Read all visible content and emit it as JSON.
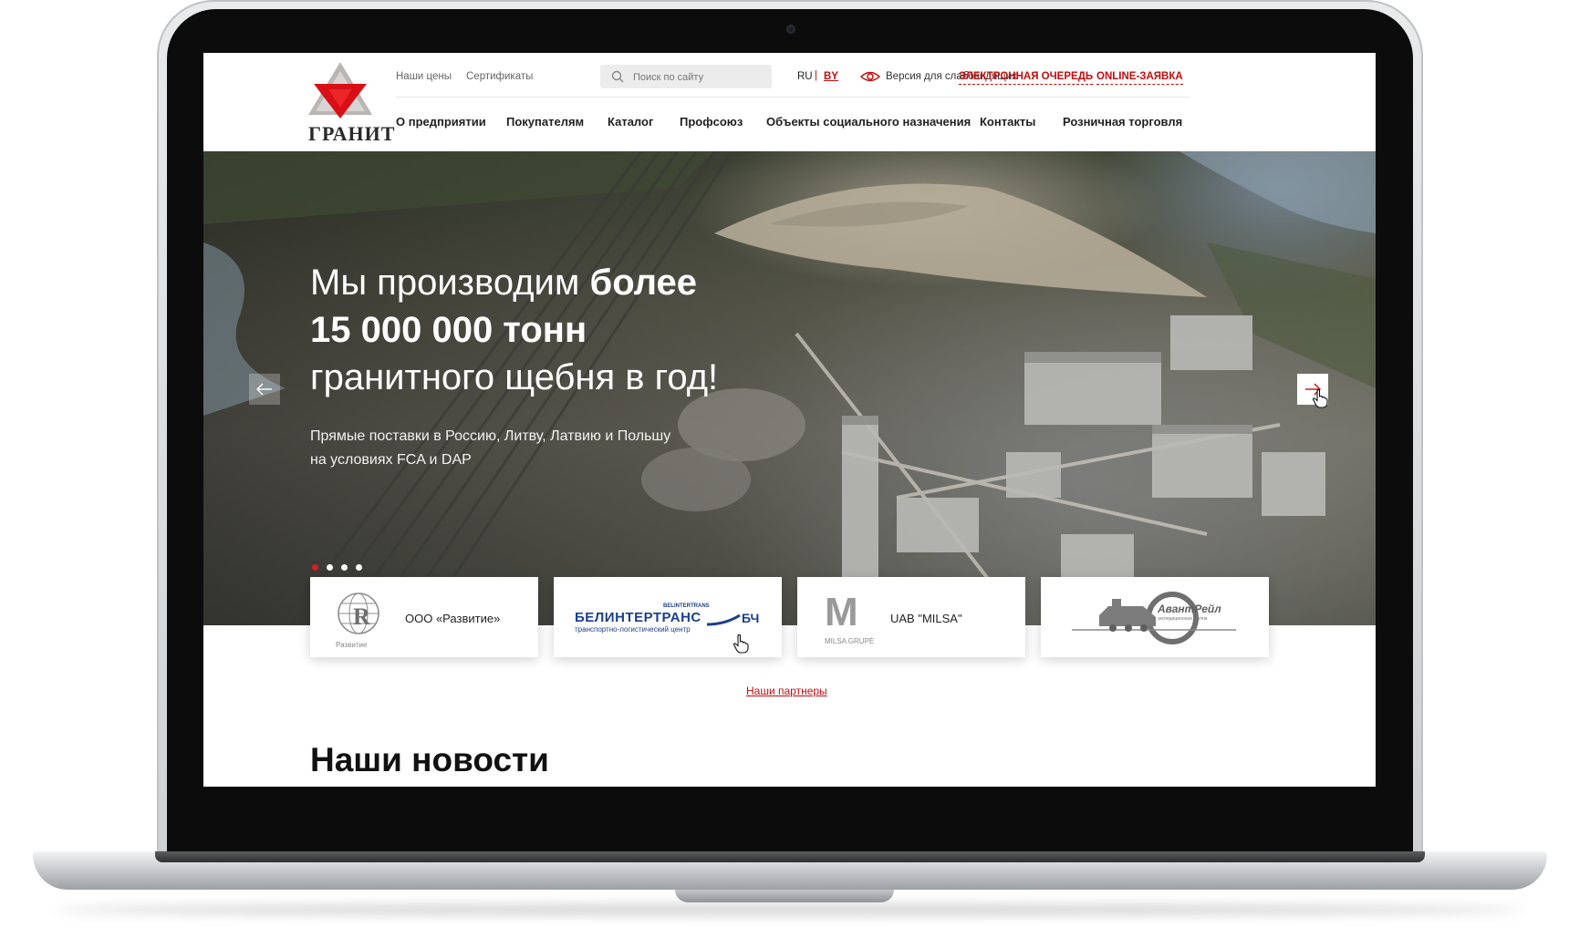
{
  "header": {
    "logo_text": "ГРАНИТ",
    "top_links": [
      "Наши цены",
      "Сертификаты"
    ],
    "search_placeholder": "Поиск по сайту",
    "lang_ru": "RU",
    "lang_sep": "|",
    "lang_by": "BY",
    "vision_label": "Версия для слабовидящих",
    "queue_label": "ЭЛЕКТРОННАЯ ОЧЕРЕДЬ",
    "online_label": "ONLINE-ЗАЯВКА",
    "nav": [
      "О предприятии",
      "Покупателям",
      "Каталог",
      "Профсоюз",
      "Объекты социального назначения",
      "Контакты",
      "Розничная торговля"
    ]
  },
  "hero": {
    "title_line1_light": "Мы производим ",
    "title_line1_bold": "более",
    "title_line2_bold": "15 000 000 тонн",
    "title_line3_light": "гранитного щебня в год!",
    "subtitle_line1": "Прямые поставки в Россию, Литву, Латвию и Польшу",
    "subtitle_line2": "на условиях FCA и DAP",
    "slide_count": 4,
    "active_slide": 1
  },
  "partners": {
    "items": [
      {
        "logo_caption": "Развитие",
        "name": "ООО «Развитие»"
      },
      {
        "logo_title": "БЕЛИНТЕРТРАНС",
        "logo_small": "BELINTERTRANS",
        "logo_badge": "БЧ",
        "logo_caption": "транспортно-логистический центр",
        "name": ""
      },
      {
        "logo_letter": "M",
        "logo_caption": "MILSA GRUPĖ",
        "name": "UAB \"MILSA\""
      },
      {
        "logo_title": "АвантРейл",
        "logo_caption": "экспедиционная группа",
        "name": ""
      }
    ],
    "link_label": "Наши партнеры"
  },
  "news": {
    "title": "Наши новости"
  },
  "colors": {
    "accent": "#c40c0c",
    "dot_active": "#d42020"
  }
}
